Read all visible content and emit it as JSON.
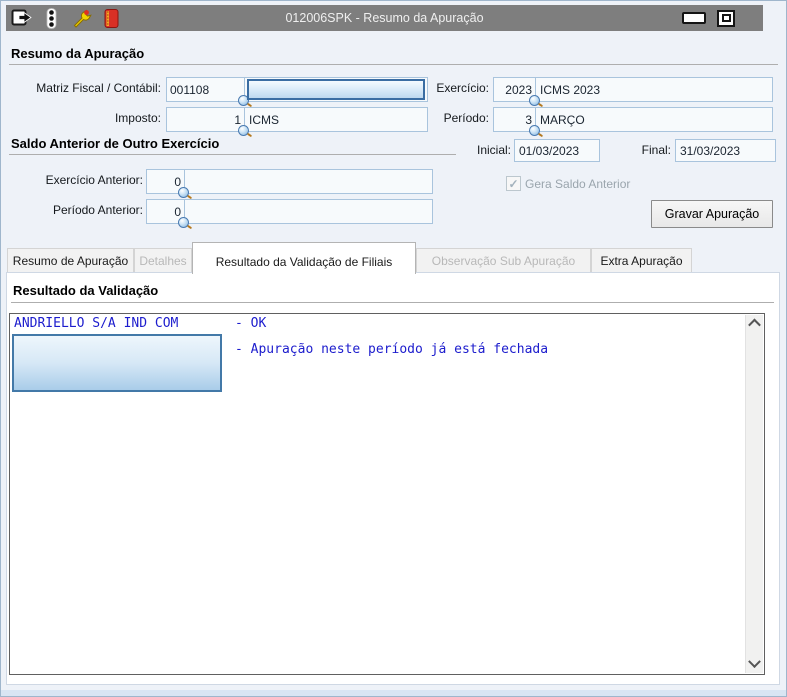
{
  "colors": {
    "titlebar_bg": "#7e7e7e",
    "focus_border": "#3a6da3",
    "field_border": "#a9c4dd",
    "validation_text": "#1c1ccd"
  },
  "titlebar": {
    "title": "012006SPK - Resumo da Apuração",
    "icons": [
      "exit-icon",
      "traffic-light-icon",
      "wrench-icon",
      "notebook-icon"
    ]
  },
  "resumo": {
    "title": "Resumo da Apuração",
    "matriz_label": "Matriz Fiscal / Contábil:",
    "matriz_code": "001108",
    "exercicio_label": "Exercício:",
    "exercicio_code": "2023",
    "exercicio_desc": "ICMS 2023",
    "imposto_label": "Imposto:",
    "imposto_code": "1",
    "imposto_desc": "ICMS",
    "periodo_label": "Período:",
    "periodo_code": "3",
    "periodo_desc": "MARÇO"
  },
  "saldo": {
    "title": "Saldo Anterior de Outro Exercício",
    "inicial_label": "Inicial:",
    "inicial_value": "01/03/2023",
    "final_label": "Final:",
    "final_value": "31/03/2023",
    "exercicio_anterior_label": "Exercício Anterior:",
    "exercicio_anterior_code": "0",
    "periodo_anterior_label": "Período Anterior:",
    "periodo_anterior_code": "0",
    "gera_saldo_label": "Gera Saldo Anterior",
    "gravar_button_label": "Gravar Apuração"
  },
  "tabs": [
    {
      "label": "Resumo de Apuração",
      "state": "enabled"
    },
    {
      "label": "Detalhes",
      "state": "disabled"
    },
    {
      "label": "Resultado da Validação de Filiais",
      "state": "selected"
    },
    {
      "label": "Observação Sub Apuração",
      "state": "disabled"
    },
    {
      "label": "Extra Apuração",
      "state": "enabled"
    }
  ],
  "validation": {
    "title": "Resultado da Validação",
    "company_name": "ANDRIELLO S/A IND COM",
    "status_line1": "- OK",
    "status_line2": "- Apuração neste período já está fechada"
  }
}
